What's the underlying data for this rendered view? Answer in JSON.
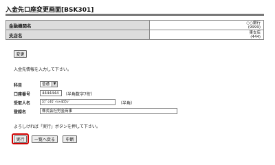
{
  "page": {
    "title": "入金先口座変更画面[BSK301]"
  },
  "info": {
    "rows": [
      {
        "label": "金融機関名",
        "value_line1": "○○銀行",
        "value_line2": "(9999)"
      },
      {
        "label": "支店名",
        "value_line1": "東支店",
        "value_line2": "(444)"
      }
    ]
  },
  "change_button": "変更",
  "instruction": "入金先情報を入力して下さい。",
  "form": {
    "account_type_label": "科目",
    "account_type_value": "普通",
    "account_number_label": "口座番号",
    "account_number_value": "4444444",
    "account_number_note": "（半角数字7桁）",
    "recipient_label": "受取人名",
    "recipient_value": "ｶﾌﾞｼｷｶﾞｲｼｬﾖﾛｳｼﾞ",
    "recipient_note": "（半角）",
    "registered_label": "登録名",
    "registered_value": "株式会社労金商事"
  },
  "confirm_text": "よろしければ「実行」ボタンを押して下さい。",
  "buttons": {
    "execute": "実行",
    "back": "一覧へ戻る",
    "cancel": "中断"
  },
  "colors": {
    "highlight": "#d00000",
    "label_bg": "#dcdcdc",
    "rule": "#777777"
  }
}
